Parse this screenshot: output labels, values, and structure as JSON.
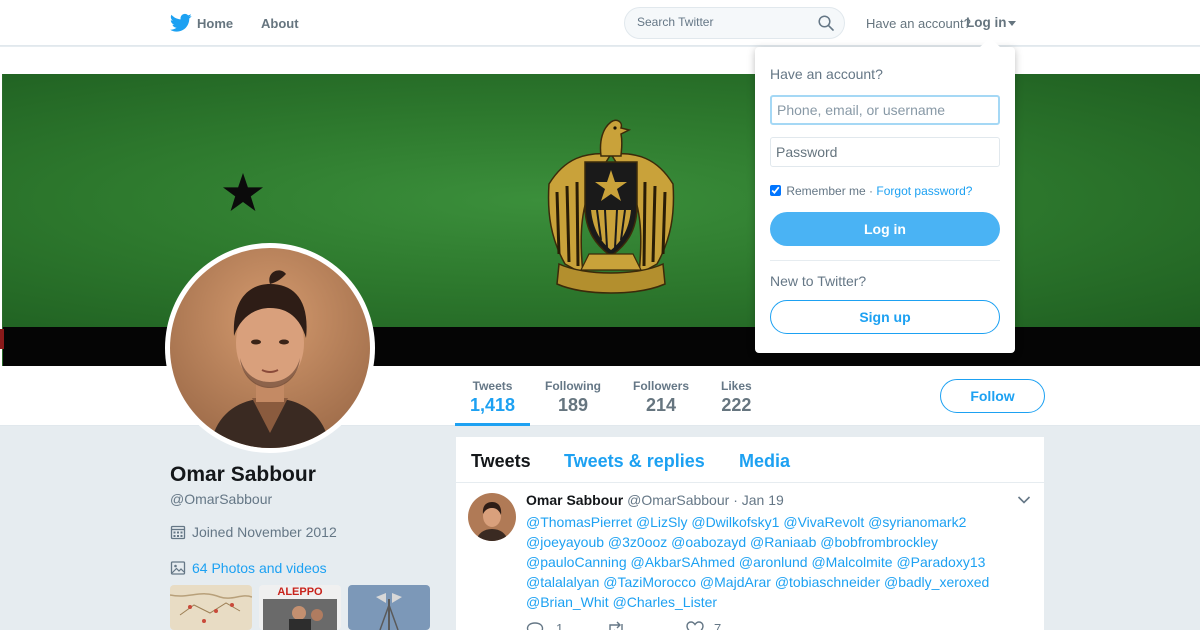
{
  "nav": {
    "home_label": "Home",
    "about_label": "About",
    "search_placeholder": "Search Twitter",
    "have_account": "Have an account?",
    "login_label": "Log in"
  },
  "stats": [
    {
      "label": "Tweets",
      "value": "1,418"
    },
    {
      "label": "Following",
      "value": "189"
    },
    {
      "label": "Followers",
      "value": "214"
    },
    {
      "label": "Likes",
      "value": "222"
    }
  ],
  "follow_label": "Follow",
  "profile": {
    "name": "Omar Sabbour",
    "handle": "@OmarSabbour",
    "joined": "Joined November 2012",
    "photos_label": "64 Photos and videos",
    "thumb_text": "ALEPPO"
  },
  "timeline": {
    "tabs": [
      "Tweets",
      "Tweets & replies",
      "Media"
    ],
    "tweet": {
      "name": "Omar Sabbour",
      "handle": "@OmarSabbour",
      "dot": "·",
      "time": "Jan 19",
      "lines": [
        "@ThomasPierret @LizSly @Dwilkofsky1 @VivaRevolt @syrianomark2",
        "@joeyayoub @3z0ooz @oabozayd @Raniaab @bobfrombrockley",
        "@pauloCanning @AkbarSAhmed @aronlund @Malcolmite @Paradoxy13",
        "@talalalyan @TaziMorocco @MajdArar @tobiaschneider @badly_xeroxed",
        "@Brian_Whit @Charles_Lister"
      ],
      "reply_count": "1",
      "like_count": "7"
    }
  },
  "login_dropdown": {
    "title": "Have an account?",
    "username_placeholder": "Phone, email, or username",
    "password_placeholder": "Password",
    "remember_label": "Remember me",
    "separator": "·",
    "forgot_label": "Forgot password?",
    "login_button": "Log in",
    "new_label": "New to Twitter?",
    "signup_button": "Sign up"
  },
  "colors": {
    "twitter_blue": "#1da1f2",
    "login_button": "#4ab3f4",
    "flag_green": "#2e7a2e",
    "background": "#e6ecf0"
  }
}
